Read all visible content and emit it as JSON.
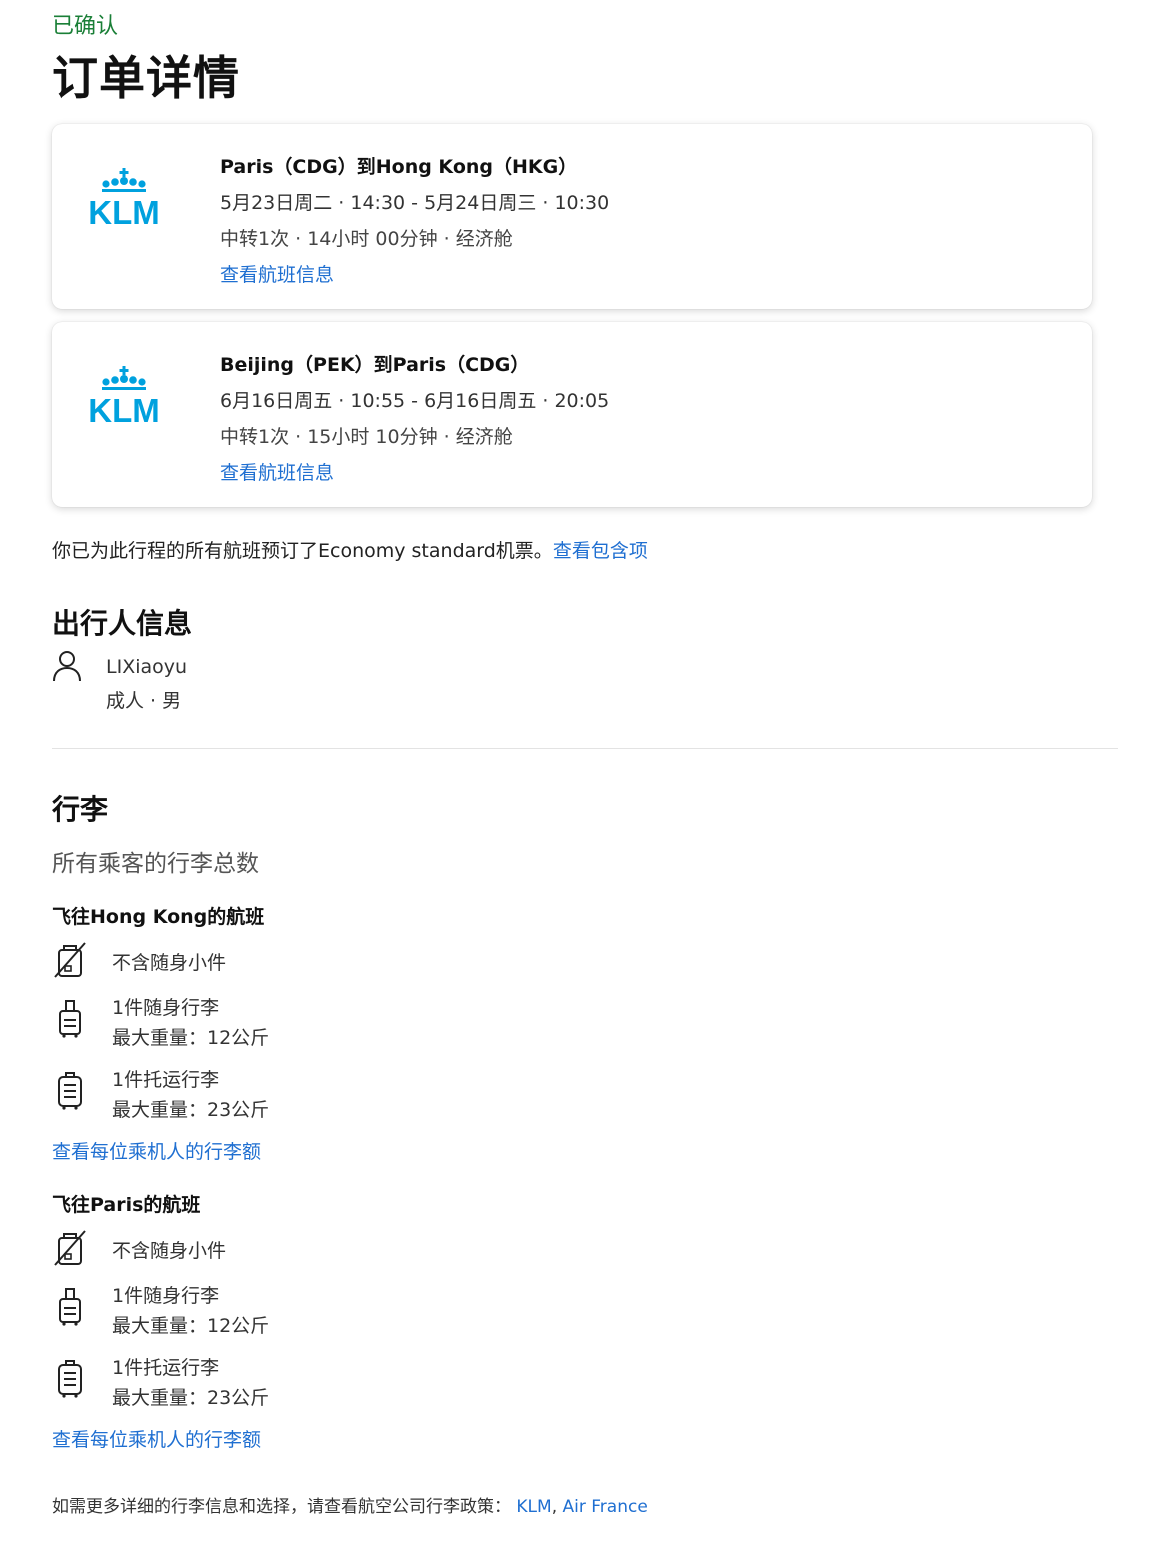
{
  "status": "已确认",
  "page_title": "订单详情",
  "brand_color": "#00A1DE",
  "flights": [
    {
      "airline_logo_text": "KLM",
      "route": "Paris（CDG）到Hong Kong（HKG）",
      "times": "5月23日周二 · 14:30 - 5月24日周三 · 10:30",
      "meta": "中转1次 · 14小时 00分钟 · 经济舱",
      "link": "查看航班信息"
    },
    {
      "airline_logo_text": "KLM",
      "route": "Beijing（PEK）到Paris（CDG）",
      "times": "6月16日周五 · 10:55 - 6月16日周五 · 20:05",
      "meta": "中转1次 · 15小时 10分钟 · 经济舱",
      "link": "查看航班信息"
    }
  ],
  "fare_note": {
    "text": "你已为此行程的所有航班预订了Economy standard机票。",
    "link": "查看包含项"
  },
  "passenger_section": {
    "title": "出行人信息",
    "icon": "person-icon",
    "name": "LIXiaoyu",
    "type": "成人 · 男"
  },
  "baggage_section": {
    "title": "行李",
    "subtitle": "所有乘客的行李总数",
    "groups": [
      {
        "heading": "飞往Hong Kong的航班",
        "items": [
          {
            "icon": "no-personal-item-icon",
            "line1": "不含随身小件",
            "line2": ""
          },
          {
            "icon": "carry-on-bag-icon",
            "line1": "1件随身行李",
            "line2": "最大重量：12公斤"
          },
          {
            "icon": "checked-bag-icon",
            "line1": "1件托运行李",
            "line2": "最大重量：23公斤"
          }
        ],
        "link": "查看每位乘机人的行李额"
      },
      {
        "heading": "飞往Paris的航班",
        "items": [
          {
            "icon": "no-personal-item-icon",
            "line1": "不含随身小件",
            "line2": ""
          },
          {
            "icon": "carry-on-bag-icon",
            "line1": "1件随身行李",
            "line2": "最大重量：12公斤"
          },
          {
            "icon": "checked-bag-icon",
            "line1": "1件托运行李",
            "line2": "最大重量：23公斤"
          }
        ],
        "link": "查看每位乘机人的行李额"
      }
    ]
  },
  "footer_note": {
    "text": "如需更多详细的行李信息和选择，请查看航空公司行李政策：",
    "links": [
      "KLM",
      "Air France"
    ],
    "separator": ", "
  }
}
